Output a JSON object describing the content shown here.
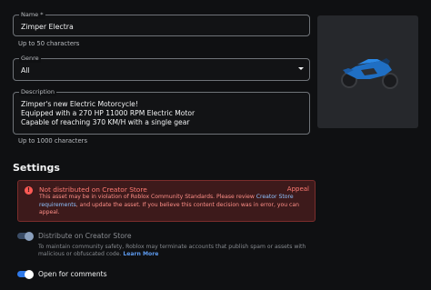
{
  "name_field": {
    "label": "Name *",
    "value": "Zimper Electra",
    "helper": "Up to 50 characters"
  },
  "genre_field": {
    "label": "Genre",
    "value": "All"
  },
  "description_field": {
    "label": "Description",
    "lines": [
      "Zimper's new Electric Motorcycle!",
      "Equipped with a 270 HP 11000 RPM Electric Motor",
      "Capable of reaching 370 KM/H with a single gear"
    ],
    "helper": "Up to 1000 characters"
  },
  "settings": {
    "heading": "Settings",
    "alert": {
      "title": "Not distributed on Creator Store",
      "appeal": "Appeal",
      "body_prefix": "This asset may be in violation of Roblox Community Standards. Please review ",
      "link": "Creator Store requirements",
      "body_suffix": ", and update the asset. If you believe this content decision was in error, you can appeal.",
      "icon": "error-icon",
      "color": "#ff5a55"
    },
    "distribute": {
      "label": "Distribute on Creator Store",
      "enabled": true,
      "disabled": true,
      "info": "To maintain community safety, Roblox may terminate accounts that publish spam or assets with malicious or obfuscated code.",
      "learn_more": "Learn More"
    },
    "comments": {
      "label": "Open for comments",
      "enabled": true
    }
  },
  "colors": {
    "accent": "#2f79e8",
    "error": "#ff5a55",
    "background": "#0f1012"
  }
}
